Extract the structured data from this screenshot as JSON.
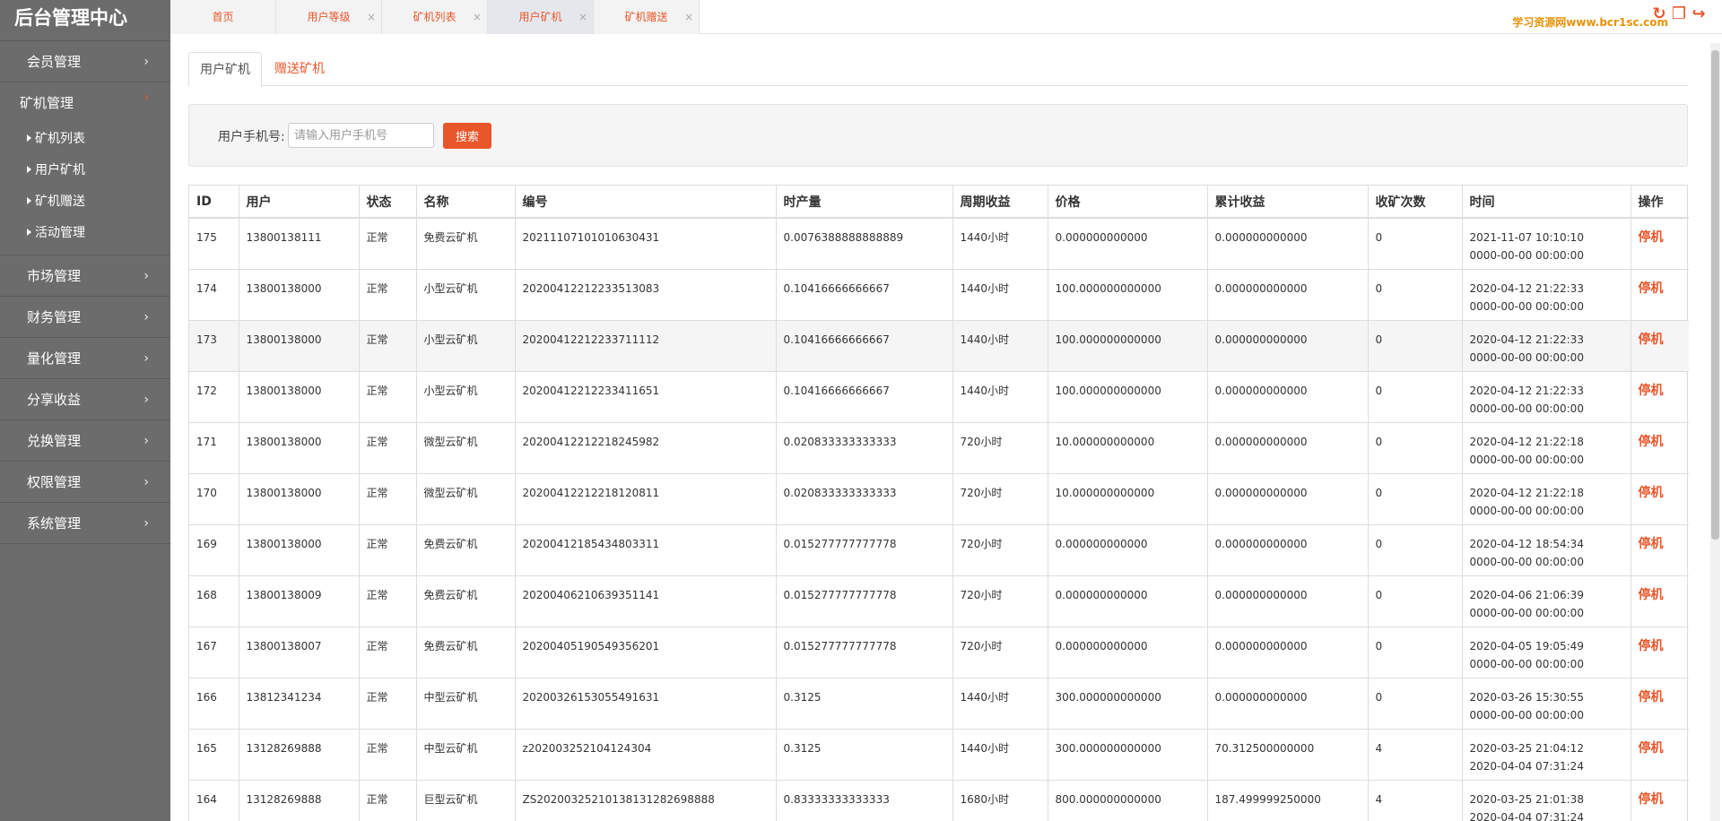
{
  "app": {
    "title": "后台管理中心"
  },
  "sidebar": {
    "items": [
      {
        "label": "会员管理"
      },
      {
        "label": "矿机管理",
        "open": true,
        "children": [
          {
            "label": "矿机列表"
          },
          {
            "label": "用户矿机"
          },
          {
            "label": "矿机赠送"
          },
          {
            "label": "活动管理"
          }
        ]
      },
      {
        "label": "市场管理"
      },
      {
        "label": "财务管理"
      },
      {
        "label": "量化管理"
      },
      {
        "label": "分享收益"
      },
      {
        "label": "兑换管理"
      },
      {
        "label": "权限管理"
      },
      {
        "label": "系统管理"
      }
    ]
  },
  "top_tabs": [
    {
      "label": "首页",
      "closable": false
    },
    {
      "label": "用户等级",
      "closable": true
    },
    {
      "label": "矿机列表",
      "closable": true
    },
    {
      "label": "用户矿机",
      "closable": true,
      "active": true
    },
    {
      "label": "矿机赠送",
      "closable": true
    }
  ],
  "header": {
    "watermark": "学习资源网www.bcr1sc.com",
    "icons": [
      "refresh-icon",
      "trash-icon",
      "logout-icon"
    ]
  },
  "sub_tabs": [
    {
      "label": "用户矿机",
      "active": true
    },
    {
      "label": "赠送矿机"
    }
  ],
  "search": {
    "label": "用户手机号:",
    "placeholder": "请输入用户手机号",
    "value": "",
    "button": "搜索"
  },
  "table": {
    "columns": [
      "ID",
      "用户",
      "状态",
      "名称",
      "编号",
      "时产量",
      "周期收益",
      "价格",
      "累计收益",
      "收矿次数",
      "时间",
      "操作"
    ],
    "action_label": "停机",
    "rows": [
      {
        "id": "175",
        "user": "13800138111",
        "status": "正常",
        "name": "免费云矿机",
        "code": "20211107101010630431",
        "hourly": "0.0076388888888889",
        "cycle": "1440小时",
        "price": "0.000000000000",
        "total": "0.000000000000",
        "count": "0",
        "time1": "2021-11-07 10:10:10",
        "time2": "0000-00-00 00:00:00"
      },
      {
        "id": "174",
        "user": "13800138000",
        "status": "正常",
        "name": "小型云矿机",
        "code": "20200412212233513083",
        "hourly": "0.10416666666667",
        "cycle": "1440小时",
        "price": "100.000000000000",
        "total": "0.000000000000",
        "count": "0",
        "time1": "2020-04-12 21:22:33",
        "time2": "0000-00-00 00:00:00"
      },
      {
        "id": "173",
        "user": "13800138000",
        "status": "正常",
        "name": "小型云矿机",
        "code": "20200412212233711112",
        "hourly": "0.10416666666667",
        "cycle": "1440小时",
        "price": "100.000000000000",
        "total": "0.000000000000",
        "count": "0",
        "time1": "2020-04-12 21:22:33",
        "time2": "0000-00-00 00:00:00"
      },
      {
        "id": "172",
        "user": "13800138000",
        "status": "正常",
        "name": "小型云矿机",
        "code": "20200412212233411651",
        "hourly": "0.10416666666667",
        "cycle": "1440小时",
        "price": "100.000000000000",
        "total": "0.000000000000",
        "count": "0",
        "time1": "2020-04-12 21:22:33",
        "time2": "0000-00-00 00:00:00"
      },
      {
        "id": "171",
        "user": "13800138000",
        "status": "正常",
        "name": "微型云矿机",
        "code": "20200412212218245982",
        "hourly": "0.020833333333333",
        "cycle": "720小时",
        "price": "10.000000000000",
        "total": "0.000000000000",
        "count": "0",
        "time1": "2020-04-12 21:22:18",
        "time2": "0000-00-00 00:00:00"
      },
      {
        "id": "170",
        "user": "13800138000",
        "status": "正常",
        "name": "微型云矿机",
        "code": "20200412212218120811",
        "hourly": "0.020833333333333",
        "cycle": "720小时",
        "price": "10.000000000000",
        "total": "0.000000000000",
        "count": "0",
        "time1": "2020-04-12 21:22:18",
        "time2": "0000-00-00 00:00:00"
      },
      {
        "id": "169",
        "user": "13800138000",
        "status": "正常",
        "name": "免费云矿机",
        "code": "20200412185434803311",
        "hourly": "0.015277777777778",
        "cycle": "720小时",
        "price": "0.000000000000",
        "total": "0.000000000000",
        "count": "0",
        "time1": "2020-04-12 18:54:34",
        "time2": "0000-00-00 00:00:00"
      },
      {
        "id": "168",
        "user": "13800138009",
        "status": "正常",
        "name": "免费云矿机",
        "code": "20200406210639351141",
        "hourly": "0.015277777777778",
        "cycle": "720小时",
        "price": "0.000000000000",
        "total": "0.000000000000",
        "count": "0",
        "time1": "2020-04-06 21:06:39",
        "time2": "0000-00-00 00:00:00"
      },
      {
        "id": "167",
        "user": "13800138007",
        "status": "正常",
        "name": "免费云矿机",
        "code": "20200405190549356201",
        "hourly": "0.015277777777778",
        "cycle": "720小时",
        "price": "0.000000000000",
        "total": "0.000000000000",
        "count": "0",
        "time1": "2020-04-05 19:05:49",
        "time2": "0000-00-00 00:00:00"
      },
      {
        "id": "166",
        "user": "13812341234",
        "status": "正常",
        "name": "中型云矿机",
        "code": "20200326153055491631",
        "hourly": "0.3125",
        "cycle": "1440小时",
        "price": "300.000000000000",
        "total": "0.000000000000",
        "count": "0",
        "time1": "2020-03-26 15:30:55",
        "time2": "0000-00-00 00:00:00"
      },
      {
        "id": "165",
        "user": "13128269888",
        "status": "正常",
        "name": "中型云矿机",
        "code": "z202003252104124304",
        "hourly": "0.3125",
        "cycle": "1440小时",
        "price": "300.000000000000",
        "total": "70.312500000000",
        "count": "4",
        "time1": "2020-03-25 21:04:12",
        "time2": "2020-04-04 07:31:24"
      },
      {
        "id": "164",
        "user": "13128269888",
        "status": "正常",
        "name": "巨型云矿机",
        "code": "ZS20200325210138131282698888",
        "hourly": "0.83333333333333",
        "cycle": "1680小时",
        "price": "800.000000000000",
        "total": "187.499999250000",
        "count": "4",
        "time1": "2020-03-25 21:01:38",
        "time2": "2020-04-04 07:31:24"
      }
    ]
  },
  "colors": {
    "accent": "#e8562a",
    "sidebar_bg": "#6c6c6c",
    "alt_row": "#f5f5f5"
  }
}
